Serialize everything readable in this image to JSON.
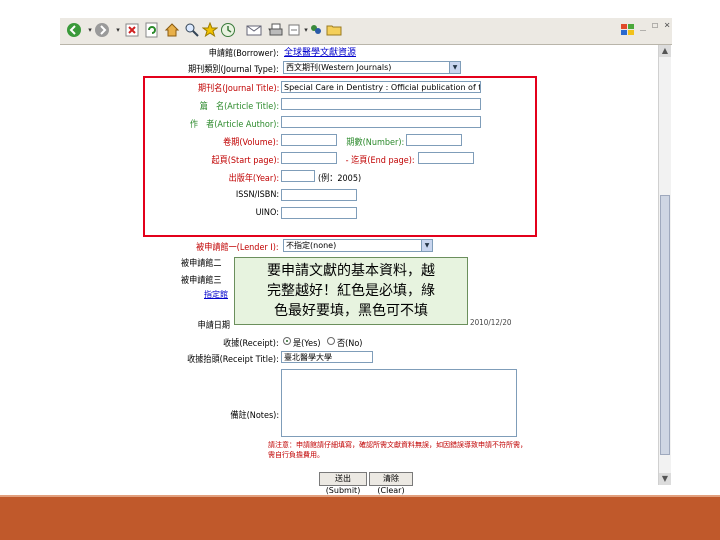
{
  "toolbar": {
    "icons": [
      "back-icon",
      "forward-icon",
      "stop-icon",
      "refresh-icon",
      "home-icon",
      "search-icon",
      "favorites-icon",
      "history-icon",
      "mail-icon",
      "print-icon",
      "edit-icon",
      "messenger-icon",
      "folder-icon"
    ],
    "window_controls": "_ ☐ ×"
  },
  "form": {
    "borrower_label": "申請館(Borrower):",
    "borrower_value": "全球醫學文獻資源",
    "journal_type_label": "期刊類別(Journal Type):",
    "journal_type_value": "西文期刊(Western Journals)",
    "journal_title_label": "期刊名(Journal Title):",
    "journal_title_value": "Special Care in Dentistry : Official publication of the Ame",
    "article_title_label": "篇　名(Article Title):",
    "article_author_label": "作　者(Article Author):",
    "volume_label": "卷期(Volume):",
    "number_label": "期數(Number):",
    "start_page_label": "起頁(Start page):",
    "end_page_label": "- 迄頁(End page):",
    "year_label": "出版年(Year):",
    "year_hint": "(例：2005)",
    "issn_label": "ISSN/ISBN:",
    "uino_label": "UINO:",
    "lender1_label": "被申請館一(Lender I):",
    "lender1_value": "不指定(none)",
    "lender2_label": "被申請館二",
    "lender3_label": "被申請館三",
    "lender_link": "指定館",
    "request_date_label": "申請日期",
    "request_date_value": "2010/12/20",
    "receipt_label": "收據(Receipt):",
    "receipt_yes": "是(Yes)",
    "receipt_no": "否(No)",
    "receipt_title_label": "收據抬頭(Receipt Title):",
    "receipt_title_value": "臺北醫學大學",
    "notes_label": "備註(Notes):",
    "note_text": "請注意：申請館請仔細填寫，確認所需文獻資料無誤，如因錯誤導致申請不符所需，需自行負擔費用。",
    "submit_label": "送出(Submit)",
    "clear_label": "清除(Clear)"
  },
  "tooltip": {
    "lines": [
      "要申請文獻的基本資料，越",
      "完整越好！紅色是必填，綠",
      "色最好要填，黑色可不填"
    ]
  },
  "colors": {
    "required": "#c00000",
    "recommended": "#2c8a2c",
    "highlight_box": "#e3001b",
    "tooltip_bg": "#e7f3df",
    "slide_band": "#c0592b"
  }
}
